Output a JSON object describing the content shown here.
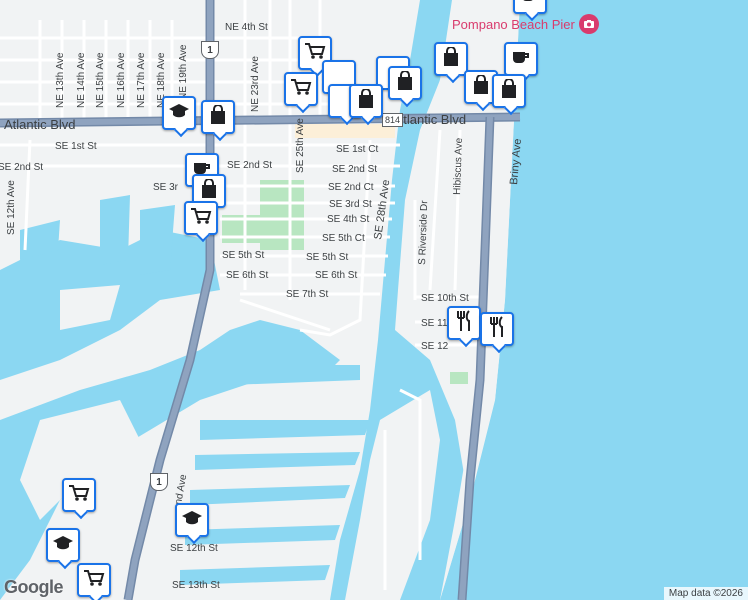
{
  "map": {
    "pier_label": "Pompano Beach Pier",
    "attribution": "Map data ©2026",
    "logo": "Google",
    "highway_shields": [
      "1",
      "1"
    ],
    "route_badges": [
      "814",
      "814"
    ],
    "colors": {
      "water": "#8bd7f2",
      "land": "#f1f3f4",
      "major_road": "#8fa3bf",
      "major_road_edge": "#7389a8",
      "park": "#b8e6c1",
      "marker_border": "#1a73e8",
      "pier_pink": "#d93b6d"
    },
    "streets": {
      "ne_4th": "NE 4th St",
      "ne_13th": "NE 13th Ave",
      "ne_14th": "NE 14th Ave",
      "ne_15th": "NE 15th Ave",
      "ne_16th": "NE 16th Ave",
      "ne_17th": "NE 17th Ave",
      "ne_18th": "NE 18th Ave",
      "ne_19th": "NE 19th Ave",
      "ne_23rd": "NE 23rd Ave",
      "se_25th": "SE 25th Ave",
      "atlantic_w": "Atlantic Blvd",
      "atlantic_e": "E Atlantic Blvd",
      "se_1st_st": "SE 1st St",
      "se_1st_ct": "SE 1st Ct",
      "se_2nd_st_w": "SE 2nd St",
      "se_2nd_st": "SE 2nd St",
      "se_2nd_st_far": "SE 2nd St",
      "se_2nd_ct": "SE 2nd Ct",
      "se_3rd_w": "SE 3r",
      "se_3rd_st": "SE 3rd St",
      "se_4th_st": "SE 4th St",
      "se_5th_ct": "SE 5th Ct",
      "se_5th_st_w": "SE 5th St",
      "se_5th_st": "SE 5th St",
      "se_6th_st_w": "SE 6th St",
      "se_6th_st": "SE 6th St",
      "se_7th_st": "SE 7th St",
      "se_28th": "SE 28th Ave",
      "se_12th_ave": "SE 12th Ave",
      "s_riverside": "S Riverside Dr",
      "hibiscus": "Hibiscus Ave",
      "briny": "Briny Ave",
      "se_10th_st": "SE 10th St",
      "se_11th": "SE 11",
      "se_12th_e": "SE 12",
      "nd_ave": "nd Ave",
      "se_12th_st": "SE 12th St",
      "se_13th_st": "SE 13th St"
    },
    "markers": [
      {
        "name": "coffee-marker-top",
        "icon": "coffee-icon"
      },
      {
        "name": "shopping-cart-marker-1",
        "icon": "shopping-cart-icon"
      },
      {
        "name": "shopping-bag-marker-1",
        "icon": "shopping-bag-icon"
      },
      {
        "name": "coffee-marker-beach",
        "icon": "coffee-icon"
      },
      {
        "name": "shopping-bag-marker-2",
        "icon": "shopping-bag-icon"
      },
      {
        "name": "shopping-bag-marker-3",
        "icon": "shopping-bag-icon"
      },
      {
        "name": "shopping-cart-marker-2",
        "icon": "shopping-cart-icon"
      },
      {
        "name": "shopping-bag-marker-4",
        "icon": "shopping-bag-icon"
      },
      {
        "name": "shopping-bag-marker-5",
        "icon": "shopping-bag-icon"
      },
      {
        "name": "school-marker-1",
        "icon": "school-icon"
      },
      {
        "name": "shopping-bag-marker-6",
        "icon": "shopping-bag-icon"
      },
      {
        "name": "coffee-marker-mid",
        "icon": "coffee-icon"
      },
      {
        "name": "shopping-bag-marker-7",
        "icon": "shopping-bag-icon"
      },
      {
        "name": "shopping-cart-marker-3",
        "icon": "shopping-cart-icon"
      },
      {
        "name": "restaurant-marker-1",
        "icon": "restaurant-icon"
      },
      {
        "name": "restaurant-marker-2",
        "icon": "restaurant-icon"
      },
      {
        "name": "shopping-cart-marker-4",
        "icon": "shopping-cart-icon"
      },
      {
        "name": "school-marker-2",
        "icon": "school-icon"
      },
      {
        "name": "school-marker-3",
        "icon": "school-icon"
      },
      {
        "name": "shopping-cart-marker-5",
        "icon": "shopping-cart-icon"
      }
    ]
  }
}
